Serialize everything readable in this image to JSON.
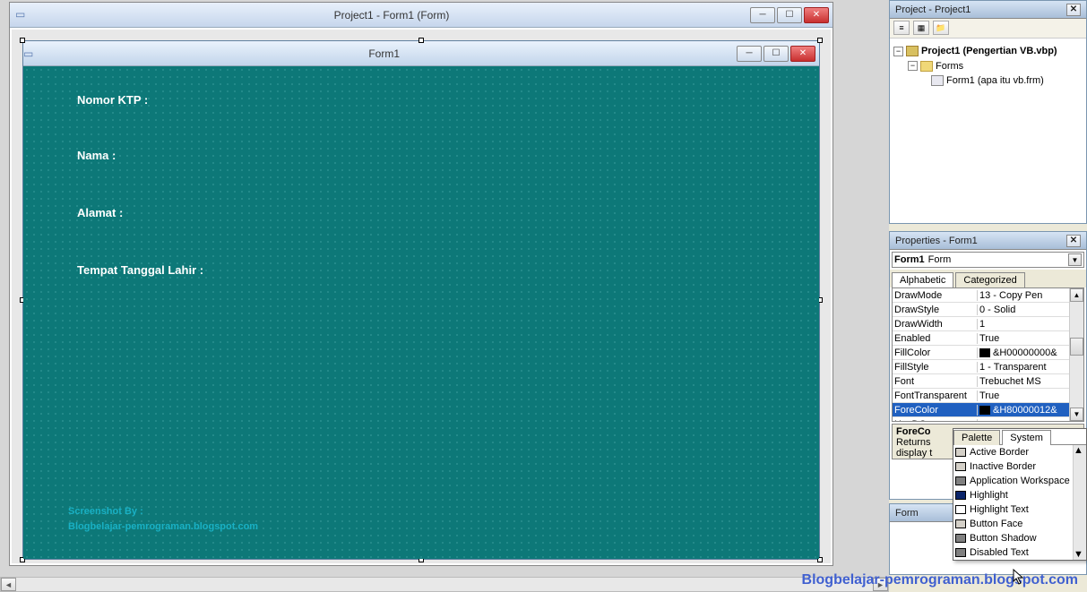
{
  "outer": {
    "title": "Project1 - Form1 (Form)"
  },
  "inner": {
    "title": "Form1"
  },
  "formLabels": {
    "l1": "Nomor KTP :",
    "l2": "Nama :",
    "l3": "Alamat :",
    "l4": "Tempat Tanggal Lahir :"
  },
  "watermark": {
    "line1": "Screenshot By :",
    "line2": "Blogbelajar-pemrograman.blogspot.com"
  },
  "watermark2": "Blogbelajar-pemrograman.blogspot.com",
  "projectPanel": {
    "title": "Project - Project1",
    "root": "Project1 (Pengertian VB.vbp)",
    "folder": "Forms",
    "item": "Form1 (apa itu vb.frm)"
  },
  "propsPanel": {
    "title": "Properties - Form1",
    "comboBold": "Form1",
    "comboType": "Form",
    "tabAlpha": "Alphabetic",
    "tabCat": "Categorized",
    "rows": [
      {
        "name": "DrawMode",
        "val": "13 - Copy Pen"
      },
      {
        "name": "DrawStyle",
        "val": "0 - Solid"
      },
      {
        "name": "DrawWidth",
        "val": "1"
      },
      {
        "name": "Enabled",
        "val": "True"
      },
      {
        "name": "FillColor",
        "val": "&H00000000&",
        "swatch": "#000000"
      },
      {
        "name": "FillStyle",
        "val": "1 - Transparent"
      },
      {
        "name": "Font",
        "val": "Trebuchet MS"
      },
      {
        "name": "FontTransparent",
        "val": "True"
      },
      {
        "name": "ForeColor",
        "val": "&H80000012&",
        "swatch": "#000000",
        "selected": true,
        "dropdown": true
      },
      {
        "name": "HasDC",
        "val": ""
      }
    ],
    "descTitle": "ForeCo",
    "descLine1": "Returns",
    "descLine2": "display t"
  },
  "colorDropdown": {
    "tabPalette": "Palette",
    "tabSystem": "System",
    "items": [
      {
        "label": "Active Border",
        "color": "#d4d0c8"
      },
      {
        "label": "Inactive Border",
        "color": "#d4d0c8"
      },
      {
        "label": "Application Workspace",
        "color": "#808080"
      },
      {
        "label": "Highlight",
        "color": "#0a246a"
      },
      {
        "label": "Highlight Text",
        "color": "#ffffff"
      },
      {
        "label": "Button Face",
        "color": "#d4d0c8"
      },
      {
        "label": "Button Shadow",
        "color": "#808080"
      },
      {
        "label": "Disabled Text",
        "color": "#808080"
      }
    ]
  },
  "formLayoutPanel": {
    "title": "Form "
  },
  "descSuffix": "to"
}
